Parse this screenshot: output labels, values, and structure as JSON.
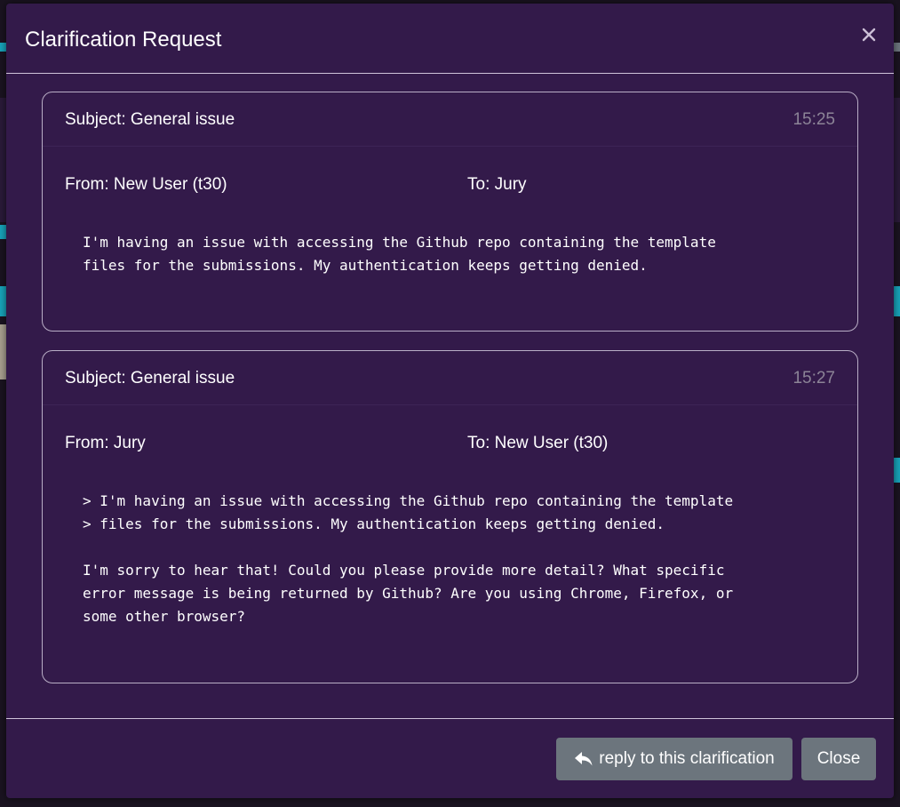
{
  "modal": {
    "title": "Clarification Request",
    "close_icon": "close-icon"
  },
  "clarifications": [
    {
      "subject": "Subject: General issue",
      "time": "15:25",
      "from": "From: New User (t30)",
      "to": "To: Jury",
      "body": "I'm having an issue with accessing the Github repo containing the template\nfiles for the submissions. My authentication keeps getting denied."
    },
    {
      "subject": "Subject: General issue",
      "time": "15:27",
      "from": "From: Jury",
      "to": "To: New User (t30)",
      "body": "> I'm having an issue with accessing the Github repo containing the template\n> files for the submissions. My authentication keeps getting denied.\n\nI'm sorry to hear that! Could you please provide more detail? What specific\nerror message is being returned by Github? Are you using Chrome, Firefox, or\nsome other browser?"
    }
  ],
  "footer": {
    "reply_label": "reply to this clarification",
    "reply_icon": "reply-icon",
    "close_label": "Close"
  },
  "colors": {
    "modal_bg": "#331a4a",
    "button_bg": "#6c757d",
    "border": "#b9aec6"
  }
}
